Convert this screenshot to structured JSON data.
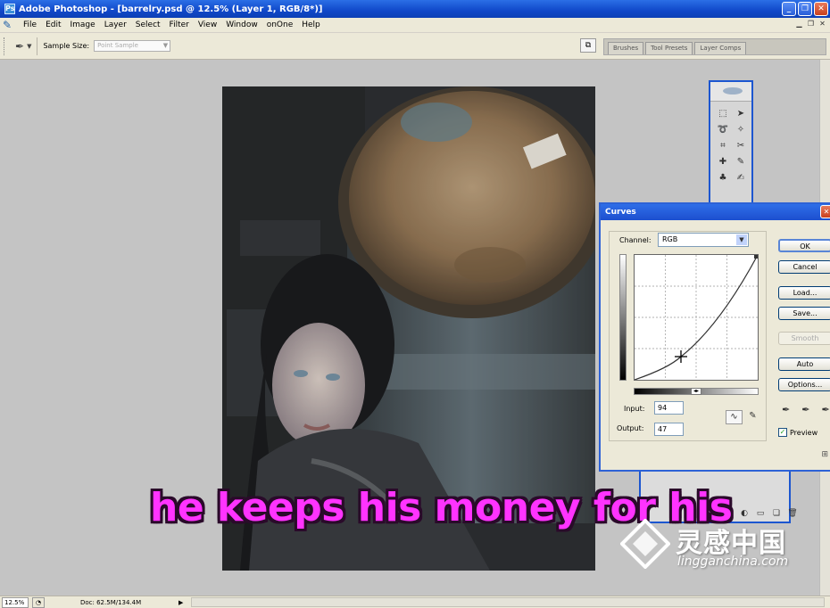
{
  "window": {
    "title": "Adobe Photoshop - [barrelry.psd @ 12.5% (Layer 1, RGB/8*)]",
    "minimize": "_",
    "restore": "❐",
    "close": "✕"
  },
  "menu": [
    "File",
    "Edit",
    "Image",
    "Layer",
    "Select",
    "Filter",
    "View",
    "Window",
    "onOne",
    "Help"
  ],
  "options": {
    "sample_size_label": "Sample Size:",
    "sample_size_value": "Point Sample",
    "palette_tabs": [
      "Brushes",
      "Tool Presets",
      "Layer Comps"
    ]
  },
  "curves": {
    "title": "Curves",
    "channel_label": "Channel:",
    "channel_value": "RGB",
    "input_label": "Input:",
    "input_value": "94",
    "output_label": "Output:",
    "output_value": "47",
    "buttons": {
      "ok": "OK",
      "cancel": "Cancel",
      "load": "Load...",
      "save": "Save...",
      "smooth": "Smooth",
      "auto": "Auto",
      "options": "Options..."
    },
    "preview_label": "Preview",
    "preview_checked": true
  },
  "status": {
    "zoom": "12.5%",
    "doc": "Doc: 62.5M/134.4M"
  },
  "overlay": {
    "subtitle": "he keeps his money for his",
    "watermark_cn": "灵感中国",
    "watermark_url": "lingganchina.com"
  }
}
